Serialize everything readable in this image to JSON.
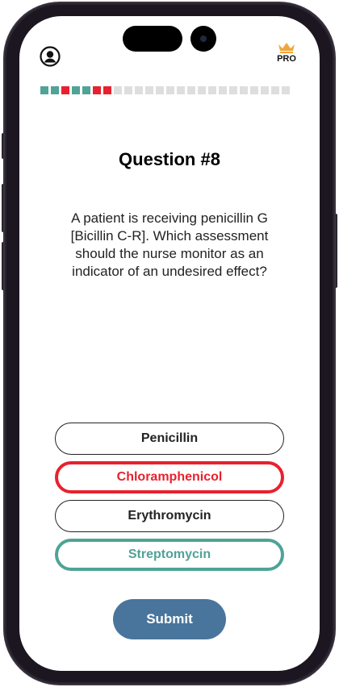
{
  "header": {
    "profile_icon": "user-circle-icon",
    "pro_icon": "crown-icon",
    "pro_label": "PRO",
    "pro_color": "#f0a63c"
  },
  "progress": {
    "current": 8,
    "total": 24,
    "segments": [
      "correct",
      "correct",
      "wrong",
      "correct",
      "correct",
      "wrong",
      "wrong",
      "pending",
      "pending",
      "pending",
      "pending",
      "pending",
      "pending",
      "pending",
      "pending",
      "pending",
      "pending",
      "pending",
      "pending",
      "pending",
      "pending",
      "pending",
      "pending",
      "pending"
    ],
    "colors": {
      "correct": "#4fa397",
      "wrong": "#e8212e",
      "pending": "#dedede"
    }
  },
  "question": {
    "title": "Question #8",
    "text": "A patient is receiving penicillin G [Bicillin C-R]. Which assessment should the nurse monitor as an indicator of an undesired effect?"
  },
  "options": [
    {
      "label": "Penicillin",
      "state": "default",
      "color": "#222222"
    },
    {
      "label": "Chloramphenicol",
      "state": "wrong",
      "color": "#e8212e"
    },
    {
      "label": "Erythromycin",
      "state": "default",
      "color": "#222222"
    },
    {
      "label": "Streptomycin",
      "state": "correct",
      "color": "#4fa397"
    }
  ],
  "submit": {
    "label": "Submit",
    "color": "#49759c"
  }
}
